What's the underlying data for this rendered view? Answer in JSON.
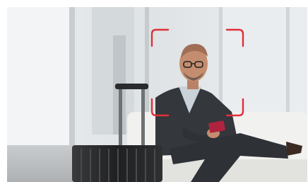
{
  "image": {
    "subject": "photo-of-man-in-suit-seated-in-airport-lounge-holding-phone-with-luggage",
    "face_detection_frame": {
      "color": "#e0303a"
    },
    "palette": {
      "suit": "#34373c",
      "shirt": "#c9d2d8",
      "skin": "#c48d6f",
      "luggage": "#2b2c2e",
      "phone_case": "#b0233e",
      "chair": "#f1f1ef"
    }
  }
}
